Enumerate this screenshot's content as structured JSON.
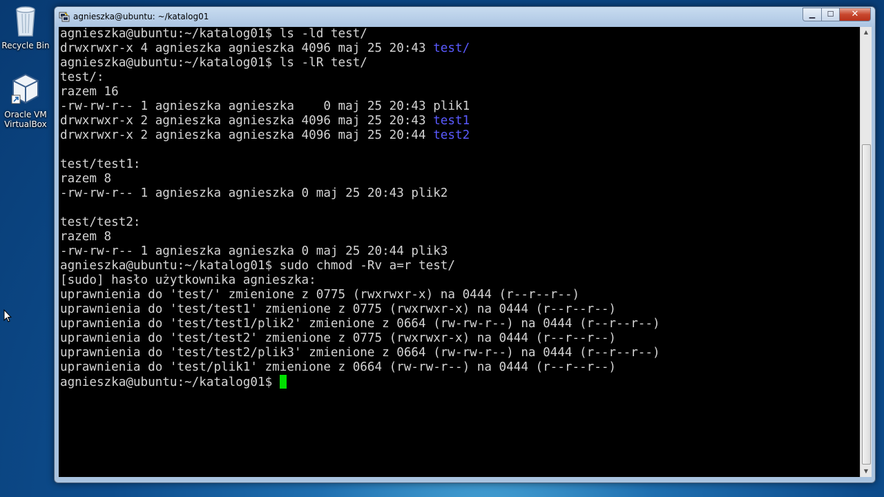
{
  "desktop": {
    "icons": [
      {
        "label": "Recycle Bin",
        "icon": "recycle-bin-icon"
      },
      {
        "label": "Oracle VM VirtualBox",
        "icon": "virtualbox-icon"
      }
    ]
  },
  "window": {
    "title": "agnieszka@ubuntu: ~/katalog01",
    "buttons": {
      "minimize": "▁",
      "maximize": "☐",
      "close": "✕"
    }
  },
  "terminal": {
    "lines": [
      {
        "text": "agnieszka@ubuntu:~/katalog01$ ls -ld test/"
      },
      {
        "text": "drwxrwxr-x 4 agnieszka agnieszka 4096 maj 25 20:43 ",
        "dir": "test/"
      },
      {
        "text": "agnieszka@ubuntu:~/katalog01$ ls -lR test/"
      },
      {
        "text": "test/:"
      },
      {
        "text": "razem 16"
      },
      {
        "text": "-rw-rw-r-- 1 agnieszka agnieszka    0 maj 25 20:43 plik1"
      },
      {
        "text": "drwxrwxr-x 2 agnieszka agnieszka 4096 maj 25 20:43 ",
        "dir": "test1"
      },
      {
        "text": "drwxrwxr-x 2 agnieszka agnieszka 4096 maj 25 20:44 ",
        "dir": "test2"
      },
      {
        "text": ""
      },
      {
        "text": "test/test1:"
      },
      {
        "text": "razem 8"
      },
      {
        "text": "-rw-rw-r-- 1 agnieszka agnieszka 0 maj 25 20:43 plik2"
      },
      {
        "text": ""
      },
      {
        "text": "test/test2:"
      },
      {
        "text": "razem 8"
      },
      {
        "text": "-rw-rw-r-- 1 agnieszka agnieszka 0 maj 25 20:44 plik3"
      },
      {
        "text": "agnieszka@ubuntu:~/katalog01$ sudo chmod -Rv a=r test/"
      },
      {
        "text": "[sudo] hasło użytkownika agnieszka:"
      },
      {
        "text": "uprawnienia do 'test/' zmienione z 0775 (rwxrwxr-x) na 0444 (r--r--r--)"
      },
      {
        "text": "uprawnienia do 'test/test1' zmienione z 0775 (rwxrwxr-x) na 0444 (r--r--r--)"
      },
      {
        "text": "uprawnienia do 'test/test1/plik2' zmienione z 0664 (rw-rw-r--) na 0444 (r--r--r--)"
      },
      {
        "text": "uprawnienia do 'test/test2' zmienione z 0775 (rwxrwxr-x) na 0444 (r--r--r--)"
      },
      {
        "text": "uprawnienia do 'test/test2/plik3' zmienione z 0664 (rw-rw-r--) na 0444 (r--r--r--)"
      },
      {
        "text": "uprawnienia do 'test/plik1' zmienione z 0664 (rw-rw-r--) na 0444 (r--r--r--)"
      }
    ],
    "prompt": "agnieszka@ubuntu:~/katalog01$ ",
    "colors": {
      "background": "#000000",
      "text": "#d3d3d3",
      "directory": "#5a5aff",
      "cursor": "#00e000"
    }
  }
}
